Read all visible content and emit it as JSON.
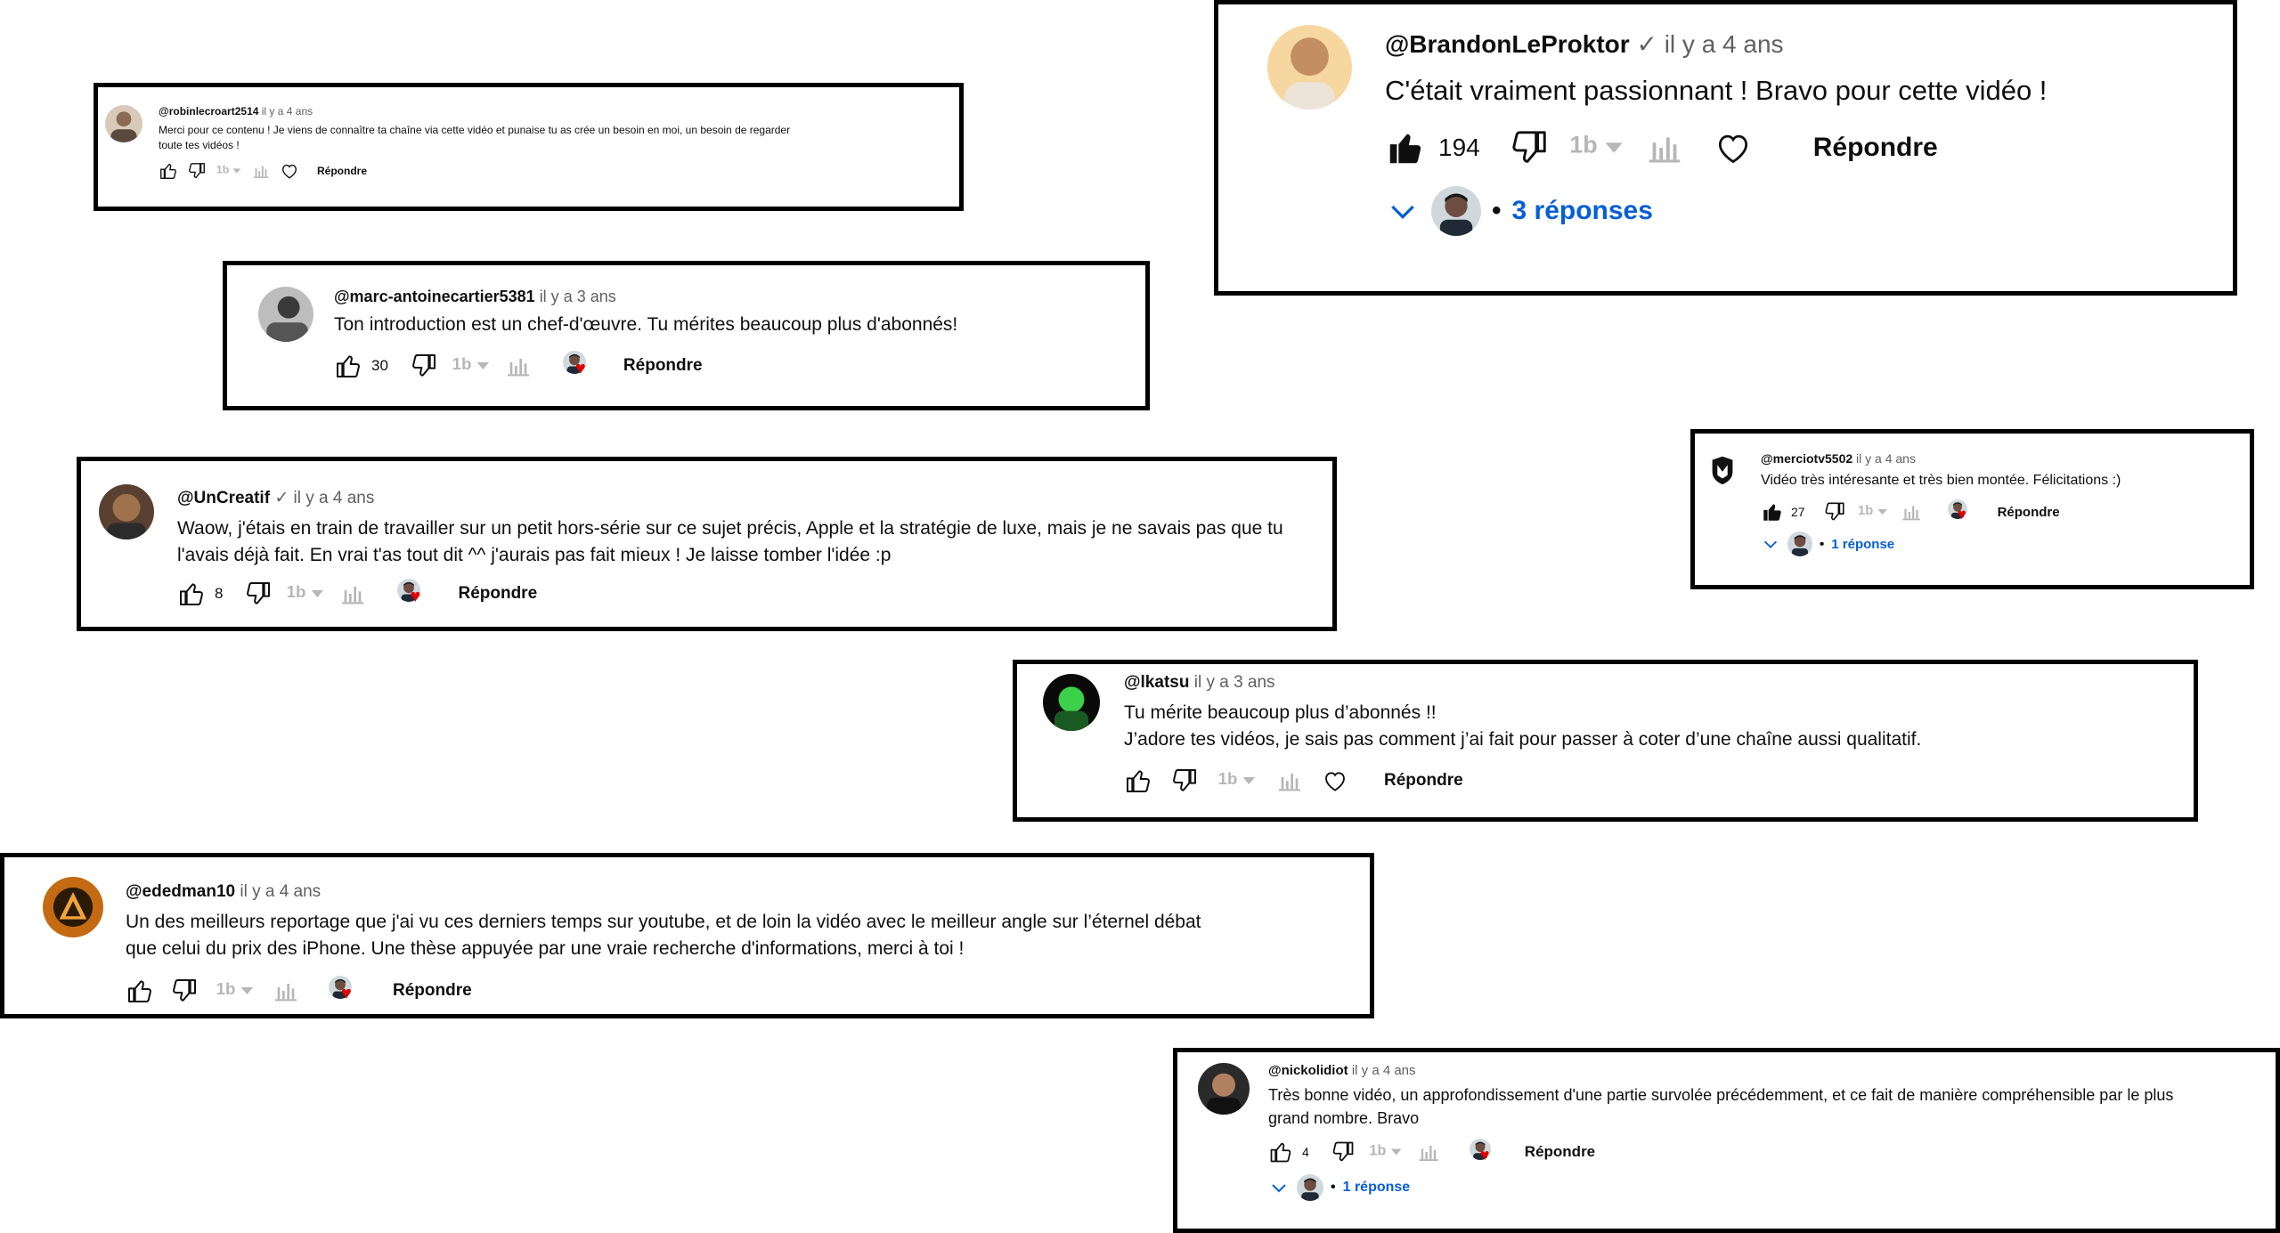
{
  "comments": [
    {
      "author": "@robinlecroart2514",
      "time": "il y a 4 ans",
      "text": [
        "Merci pour ce contenu ! Je viens de connaître ta chaîne via cette vidéo et punaise tu as crée un besoin en moi, un besoin de regarder",
        "toute tes vidéos !"
      ],
      "likes": "",
      "reply_label": "Répondre"
    },
    {
      "author": "@BrandonLeProktor",
      "verified": "✓",
      "time": "il y a 4 ans",
      "text": [
        "C'était vraiment passionnant ! Bravo pour cette vidéo !"
      ],
      "likes": "194",
      "reply_label": "Répondre",
      "replies_label": "3 réponses"
    },
    {
      "author": "@marc-antoinecartier5381",
      "time": "il y a 3 ans",
      "text": [
        "Ton introduction est un chef-d'œuvre. Tu mérites beaucoup plus d'abonnés!"
      ],
      "likes": "30",
      "reply_label": "Répondre"
    },
    {
      "author": "@UnCreatif",
      "verified": "✓",
      "time": "il y a 4 ans",
      "text": [
        "Waow, j'étais en train de travailler sur un petit hors-série sur ce sujet précis, Apple et la stratégie de luxe, mais je ne savais pas que tu",
        "l'avais déjà fait. En vrai t'as tout dit ^^ j'aurais pas fait mieux ! Je laisse tomber l'idée :p"
      ],
      "likes": "8",
      "reply_label": "Répondre"
    },
    {
      "author": "@merciotv5502",
      "time": "il y a 4 ans",
      "text": [
        "Vidéo très intéresante et très bien montée. Félicitations :)"
      ],
      "likes": "27",
      "reply_label": "Répondre",
      "replies_label": "1 réponse"
    },
    {
      "author": "@lkatsu",
      "time": "il y a 3 ans",
      "text": [
        "Tu mérite beaucoup plus d’abonnés !!",
        "J’adore tes vidéos, je sais pas comment j’ai fait pour passer à coter d’une chaîne aussi qualitatif."
      ],
      "likes": "",
      "reply_label": "Répondre"
    },
    {
      "author": "@ededman10",
      "time": "il y a 4 ans",
      "text": [
        "Un des meilleurs reportage que j'ai vu ces derniers temps sur youtube, et de loin la vidéo avec le meilleur angle sur l’éternel débat",
        "que celui du prix des iPhone. Une thèse appuyée par une vraie recherche d'informations, merci à toi !"
      ],
      "likes": "",
      "reply_label": "Répondre"
    },
    {
      "author": "@nickolidiot",
      "time": "il y a 4 ans",
      "text": [
        "Très bonne vidéo, un approfondissement d'une partie survolée précédemment, et ce fait de manière compréhensible par le plus",
        "grand nombre. Bravo"
      ],
      "likes": "4",
      "reply_label": "Répondre",
      "replies_label": "1 réponse"
    }
  ],
  "icons": {
    "like": "thumbs-up-icon",
    "dislike": "thumbs-down-icon",
    "translate": "translate-icon",
    "stats": "stats-icon",
    "heart": "heart-icon",
    "creator_heart": "creator-heart-icon",
    "expand": "chevron-down-icon"
  },
  "colors": {
    "border": "#000000",
    "reply_link": "#065fd4",
    "heart": "#e00000",
    "icon": "#606060"
  }
}
